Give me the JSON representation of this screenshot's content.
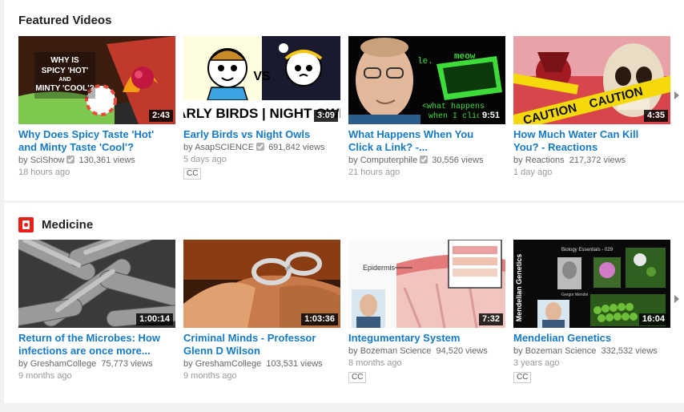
{
  "featured": {
    "title": "Featured Videos",
    "videos": [
      {
        "title_line1": "Why Does Spicy Taste 'Hot'",
        "title_line2": "and Minty Taste 'Cool'?",
        "channel": "SciShow",
        "verified": true,
        "views": "130,361 views",
        "age": "18 hours ago",
        "duration": "2:43",
        "cc": ""
      },
      {
        "title_line1": "Early Birds vs Night Owls",
        "title_line2": "",
        "channel": "AsapSCIENCE",
        "verified": true,
        "views": "691,842 views",
        "age": "5 days ago",
        "duration": "3:09",
        "cc": "CC"
      },
      {
        "title_line1": "What Happens When You",
        "title_line2": "Click a Link? -...",
        "channel": "Computerphile",
        "verified": true,
        "views": "30,556 views",
        "age": "21 hours ago",
        "duration": "9:51",
        "cc": ""
      },
      {
        "title_line1": "How Much Water Can Kill",
        "title_line2": "You? - Reactions",
        "channel": "Reactions",
        "verified": false,
        "views": "217,372 views",
        "age": "1 day ago",
        "duration": "4:35",
        "cc": ""
      }
    ]
  },
  "medicine": {
    "title": "Medicine",
    "videos": [
      {
        "title_line1": "Return of the Microbes: How",
        "title_line2": "infections are once more...",
        "channel": "GreshamCollege",
        "verified": false,
        "views": "75,773 views",
        "age": "9 months ago",
        "duration": "1:00:14",
        "cc": ""
      },
      {
        "title_line1": "Criminal Minds - Professor",
        "title_line2": "Glenn D Wilson",
        "channel": "GreshamCollege",
        "verified": false,
        "views": "103,531 views",
        "age": "9 months ago",
        "duration": "1:03:36",
        "cc": ""
      },
      {
        "title_line1": "Integumentary System",
        "title_line2": "",
        "channel": "Bozeman Science",
        "verified": false,
        "views": "94,520 views",
        "age": "8 months ago",
        "duration": "7:32",
        "cc": "CC"
      },
      {
        "title_line1": "Mendelian Genetics",
        "title_line2": "",
        "channel": "Bozeman Science",
        "verified": false,
        "views": "332,532 views",
        "age": "3 years ago",
        "duration": "16:04",
        "cc": "CC"
      }
    ]
  },
  "thumb_text": {
    "scishow": [
      "WHY IS",
      "SPICY 'HOT'",
      "AND",
      "MINTY 'COOL'?"
    ],
    "asap": "EARLY BIRDS | NIGHT OWLS",
    "asap_vs": "VS",
    "computerphile_top": "le. ",
    "computerphile_meow": "meow",
    "computerphile_q1": "<what happens",
    "computerphile_q2": "when I click?>",
    "caution": "CAUTION",
    "epidermis": "Epidermis",
    "bio_essentials": "Biology Essentials - 029",
    "mendelian_side": "Mendelian Genetics",
    "gregor": "Gregor Mendel"
  },
  "icons": {
    "shelf_icon": "medicine-channel-icon",
    "next": "chevron-right-icon",
    "verified": "verified-check-icon"
  },
  "colors": {
    "link": "#167ac6",
    "accent_red": "#e62117",
    "meta_gray": "#666666"
  }
}
